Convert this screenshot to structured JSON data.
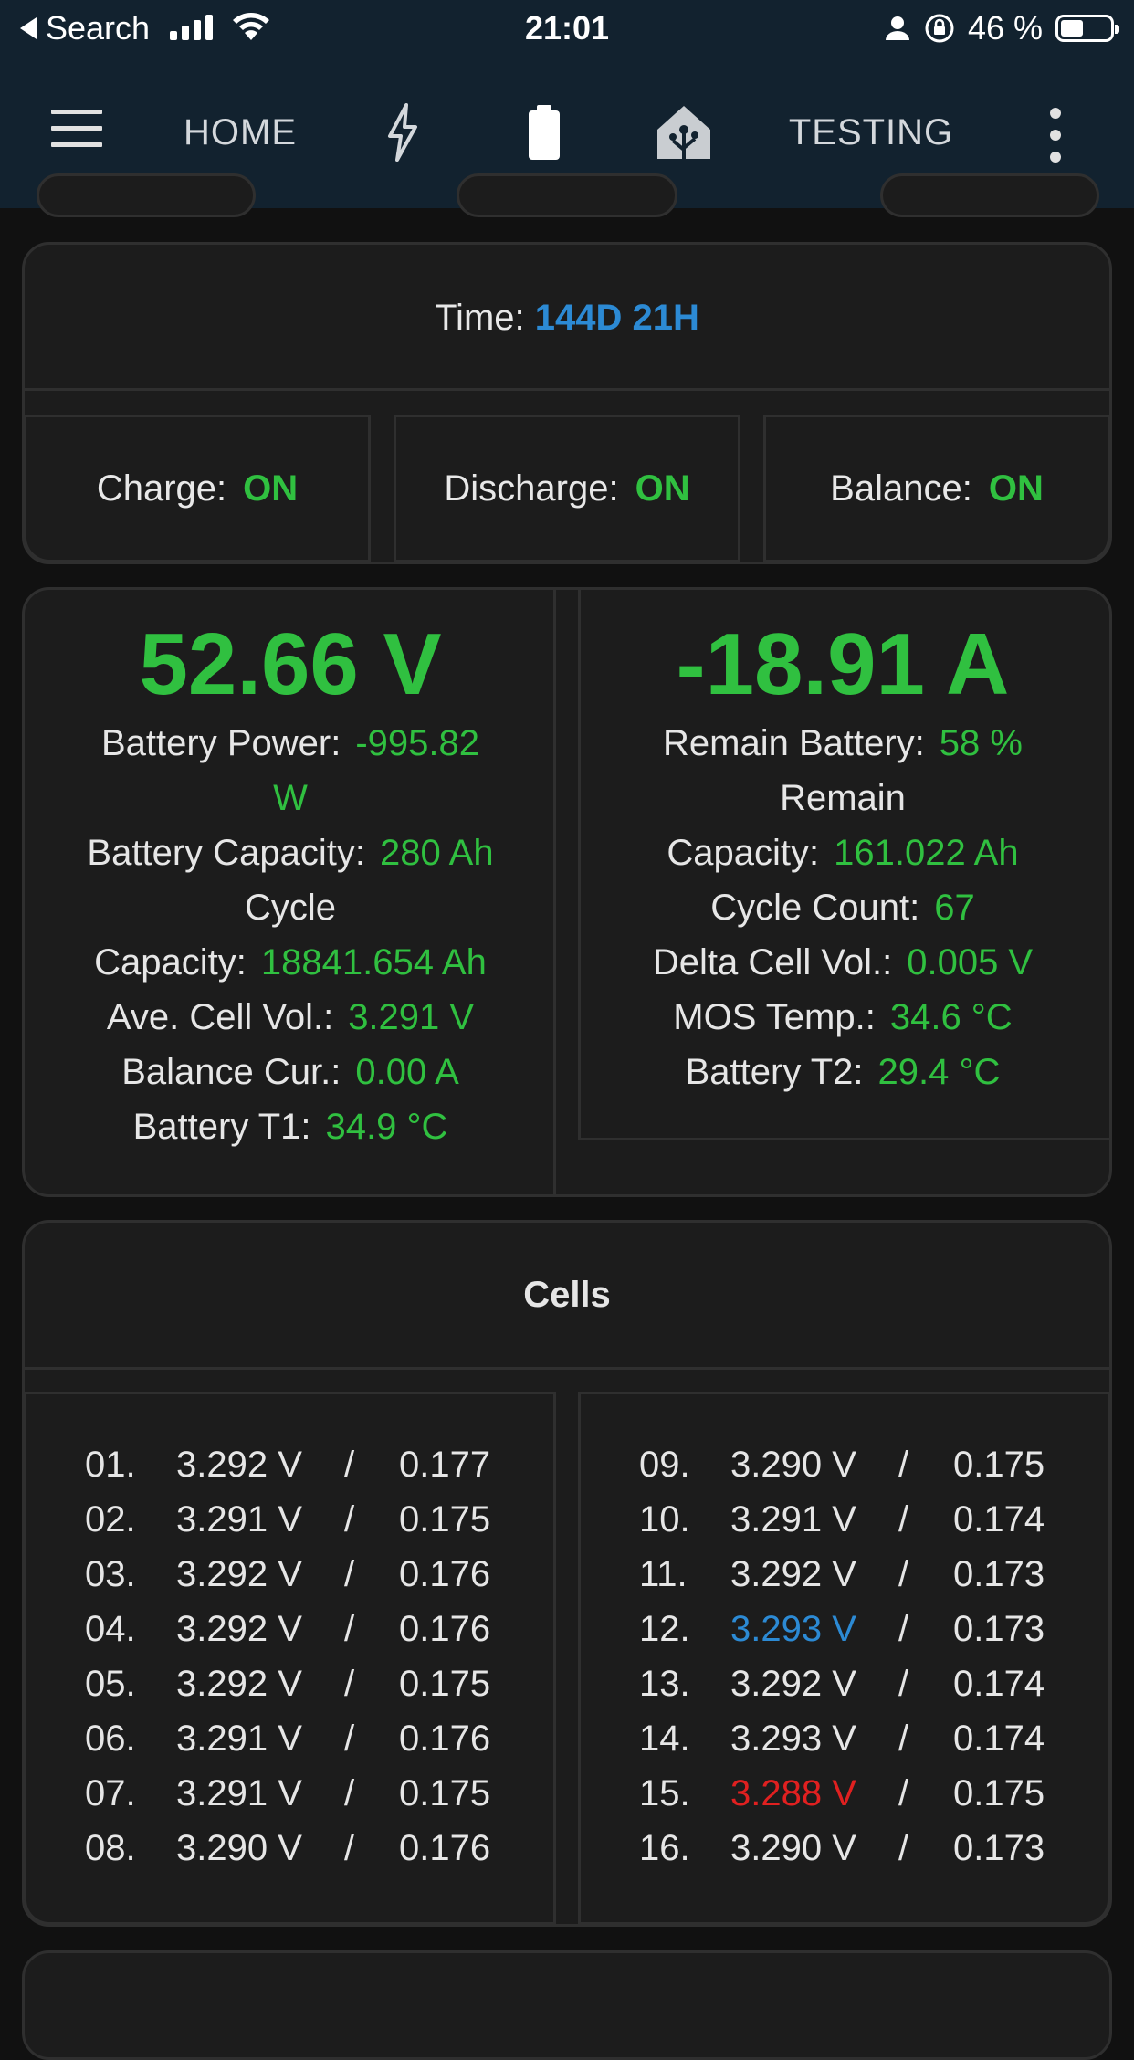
{
  "status_bar": {
    "back_label": "Search",
    "time": "21:01",
    "battery_percent": "46 %",
    "battery_level": 0.46
  },
  "app_bar": {
    "tabs": [
      {
        "label": "HOME",
        "type": "text"
      },
      {
        "icon": "lightning-icon"
      },
      {
        "icon": "battery-icon",
        "active": true
      },
      {
        "icon": "home-network-icon"
      },
      {
        "label": "TESTING",
        "type": "text"
      }
    ]
  },
  "summary": {
    "time_label": "Time:",
    "time_value": "144D 21H",
    "charge_label": "Charge:",
    "charge_value": "ON",
    "discharge_label": "Discharge:",
    "discharge_value": "ON",
    "balance_label": "Balance:",
    "balance_value": "ON"
  },
  "stats": {
    "voltage": "52.66 V",
    "current": "-18.91 A",
    "left": {
      "battery_power_label": "Battery Power:",
      "battery_power_value": "-995.82",
      "battery_power_unit": "W",
      "battery_capacity_label": "Battery Capacity:",
      "battery_capacity_value": "280 Ah",
      "cycle_label": "Cycle",
      "cycle_capacity_label": "Capacity:",
      "cycle_capacity_value": "18841.654 Ah",
      "ave_cell_label": "Ave. Cell Vol.:",
      "ave_cell_value": "3.291 V",
      "balance_cur_label": "Balance Cur.:",
      "balance_cur_value": "0.00 A",
      "battery_t1_label": "Battery T1:",
      "battery_t1_value": "34.9 °C"
    },
    "right": {
      "remain_battery_label": "Remain Battery:",
      "remain_battery_value": "58 %",
      "remain_label": "Remain",
      "remain_capacity_label": "Capacity:",
      "remain_capacity_value": "161.022 Ah",
      "cycle_count_label": "Cycle Count:",
      "cycle_count_value": "67",
      "delta_cell_label": "Delta Cell Vol.:",
      "delta_cell_value": "0.005 V",
      "mos_temp_label": "MOS Temp.:",
      "mos_temp_value": "34.6 °C",
      "battery_t2_label": "Battery T2:",
      "battery_t2_value": "29.4 °C"
    }
  },
  "cells": {
    "title": "Cells",
    "separator": "/",
    "left": [
      {
        "index": "01.",
        "voltage": "3.292 V",
        "resistance": "0.177",
        "highlight": ""
      },
      {
        "index": "02.",
        "voltage": "3.291 V",
        "resistance": "0.175",
        "highlight": ""
      },
      {
        "index": "03.",
        "voltage": "3.292 V",
        "resistance": "0.176",
        "highlight": ""
      },
      {
        "index": "04.",
        "voltage": "3.292 V",
        "resistance": "0.176",
        "highlight": ""
      },
      {
        "index": "05.",
        "voltage": "3.292 V",
        "resistance": "0.175",
        "highlight": ""
      },
      {
        "index": "06.",
        "voltage": "3.291 V",
        "resistance": "0.176",
        "highlight": ""
      },
      {
        "index": "07.",
        "voltage": "3.291 V",
        "resistance": "0.175",
        "highlight": ""
      },
      {
        "index": "08.",
        "voltage": "3.290 V",
        "resistance": "0.176",
        "highlight": ""
      }
    ],
    "right": [
      {
        "index": "09.",
        "voltage": "3.290 V",
        "resistance": "0.175",
        "highlight": ""
      },
      {
        "index": "10.",
        "voltage": "3.291 V",
        "resistance": "0.174",
        "highlight": ""
      },
      {
        "index": "11.",
        "voltage": "3.292 V",
        "resistance": "0.173",
        "highlight": ""
      },
      {
        "index": "12.",
        "voltage": "3.293 V",
        "resistance": "0.173",
        "highlight": "max"
      },
      {
        "index": "13.",
        "voltage": "3.292 V",
        "resistance": "0.174",
        "highlight": ""
      },
      {
        "index": "14.",
        "voltage": "3.293 V",
        "resistance": "0.174",
        "highlight": ""
      },
      {
        "index": "15.",
        "voltage": "3.288 V",
        "resistance": "0.175",
        "highlight": "min"
      },
      {
        "index": "16.",
        "voltage": "3.290 V",
        "resistance": "0.173",
        "highlight": ""
      }
    ]
  },
  "colors": {
    "header_bg": "#12222f",
    "card_bg": "#1c1c1c",
    "value_green": "#30c040",
    "value_blue": "#2c8ad4",
    "value_red": "#e02020"
  }
}
